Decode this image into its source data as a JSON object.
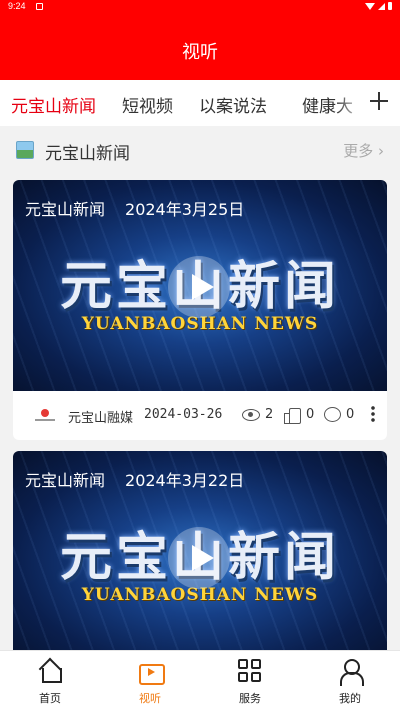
{
  "status_bar": {
    "time": "9:24"
  },
  "header": {
    "title": "视听"
  },
  "tabs": [
    {
      "label": "元宝山新闻",
      "active": true
    },
    {
      "label": "短视频",
      "active": false
    },
    {
      "label": "以案说法",
      "active": false
    },
    {
      "label": "健康大",
      "active": false
    }
  ],
  "section": {
    "title": "元宝山新闻",
    "more": "更多 ›"
  },
  "videos": [
    {
      "caption_title": "元宝山新闻",
      "caption_date": "2024年3月25日",
      "logo_text_cn": "元宝山新闻",
      "logo_text_en": "YUANBAOSHAN NEWS",
      "source": "元宝山融媒",
      "date": "2024-03-26",
      "views": "2",
      "likes": "0",
      "comments": "0"
    },
    {
      "caption_title": "元宝山新闻",
      "caption_date": "2024年3月22日",
      "logo_text_cn": "元宝山新闻",
      "logo_text_en": "YUANBAOSHAN NEWS"
    }
  ],
  "bottom_nav": [
    {
      "label": "首页",
      "icon": "home-icon",
      "active": false
    },
    {
      "label": "视听",
      "icon": "tv-icon",
      "active": true
    },
    {
      "label": "服务",
      "icon": "grid-icon",
      "active": false
    },
    {
      "label": "我的",
      "icon": "user-icon",
      "active": false
    }
  ],
  "colors": {
    "header": "#ff0000",
    "active_tab": "#e60012",
    "active_nav": "#f07a12",
    "news_logo_en": "#ffd43b"
  }
}
